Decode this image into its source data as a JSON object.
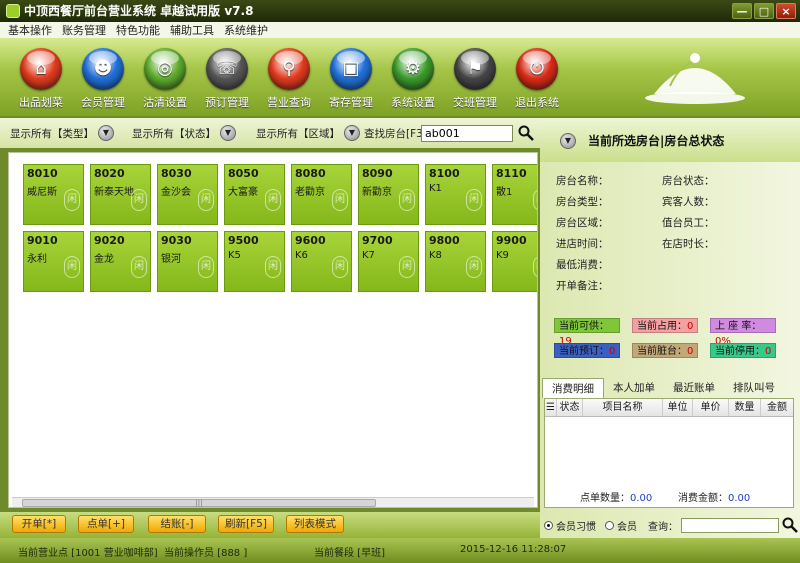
{
  "window": {
    "title": "中顶西餐厅前台营业系统 卓越试用版 v7.8",
    "controls": [
      "—",
      "□",
      "×"
    ]
  },
  "menu": [
    "基本操作",
    "账务管理",
    "特色功能",
    "辅助工具",
    "系统维护"
  ],
  "toolbar": [
    {
      "label": "出品划菜",
      "icon": "cloche-icon",
      "color": "#e03a1c",
      "glyph": "⌂"
    },
    {
      "label": "会员管理",
      "icon": "member-icon",
      "color": "#1f6fd8",
      "glyph": "☻"
    },
    {
      "label": "沽清设置",
      "icon": "plate-icon",
      "color": "#5caa2a",
      "glyph": "◎"
    },
    {
      "label": "预订管理",
      "icon": "phone-icon",
      "color": "#555555",
      "glyph": "☏"
    },
    {
      "label": "营业查询",
      "icon": "magnifier-icon",
      "color": "#e03a1c",
      "glyph": "⚲"
    },
    {
      "label": "寄存管理",
      "icon": "bag-icon",
      "color": "#1f6fd8",
      "glyph": "▣"
    },
    {
      "label": "系统设置",
      "icon": "gear-icon",
      "color": "#3a9a2a",
      "glyph": "⚙"
    },
    {
      "label": "交班管理",
      "icon": "handover-icon",
      "color": "#444444",
      "glyph": "⚑"
    },
    {
      "label": "退出系统",
      "icon": "power-icon",
      "color": "#d82a16",
      "glyph": "⏻"
    }
  ],
  "filters": {
    "type_label": "显示所有【类型】",
    "state_label": "显示所有【状态】",
    "area_label": "显示所有【区域】",
    "search_label": "查找房台[F3]",
    "search_value": "ab001"
  },
  "rooms": [
    {
      "no": "8010",
      "name": "威尼斯"
    },
    {
      "no": "8020",
      "name": "新泰天地"
    },
    {
      "no": "8030",
      "name": "金沙会"
    },
    {
      "no": "8050",
      "name": "大富豪"
    },
    {
      "no": "8080",
      "name": "老勸京"
    },
    {
      "no": "8090",
      "name": "新勸京"
    },
    {
      "no": "8100",
      "name": "K1"
    },
    {
      "no": "8110",
      "name": "散1"
    },
    {
      "no": "9010",
      "name": "永利"
    },
    {
      "no": "9020",
      "name": "金龙"
    },
    {
      "no": "9030",
      "name": "银河"
    },
    {
      "no": "9500",
      "name": "K5"
    },
    {
      "no": "9600",
      "name": "K6"
    },
    {
      "no": "9700",
      "name": "K7"
    },
    {
      "no": "9800",
      "name": "K8"
    },
    {
      "no": "9900",
      "name": "K9"
    }
  ],
  "actions": [
    {
      "label": "开单[*]"
    },
    {
      "label": "点单[+]"
    },
    {
      "label": "结账[-]"
    },
    {
      "label": "刷新[F5]"
    },
    {
      "label": "列表模式"
    }
  ],
  "panel": {
    "title": "当前所选房台|房台总状态",
    "info_left": [
      "房台名称：",
      "房台类型：",
      "房台区域：",
      "进店时间：",
      "最低消费：",
      "开单备注："
    ],
    "info_right": [
      "房台状态：",
      "宾客人数：",
      "值台员工：",
      "在店时长："
    ],
    "stats": [
      {
        "label": "当前可供：",
        "value": "19",
        "color": "#7fc63a"
      },
      {
        "label": "当前占用：",
        "value": "0",
        "color": "#f4a0a0"
      },
      {
        "label": "上 座 率：",
        "value": "0%",
        "color": "#d08adf"
      },
      {
        "label": "当前预订：",
        "value": "0",
        "color": "#3a5fc0"
      },
      {
        "label": "当前脏台：",
        "value": "0",
        "color": "#c2a878"
      },
      {
        "label": "当前停用：",
        "value": "0",
        "color": "#3ac88a"
      }
    ],
    "tabs": [
      "消费明细",
      "本人加单",
      "最近账单",
      "排队叫号"
    ],
    "columns": [
      "状态",
      "项目名称",
      "单位",
      "单价",
      "数量",
      "金额"
    ],
    "totals": {
      "count_label": "点单数量：",
      "count_value": "0.00",
      "amount_label": "消费金额：",
      "amount_value": "0.00"
    },
    "options": {
      "opt1": "会员习惯",
      "opt2": "会员",
      "query_label": "查询："
    }
  },
  "status": {
    "point": "当前营业点 [1001 营业咖啡部]",
    "operator": "当前操作员 [888 ]",
    "shift": "当前餐段 [早班]",
    "datetime": "2015-12-16 11:28:07"
  }
}
